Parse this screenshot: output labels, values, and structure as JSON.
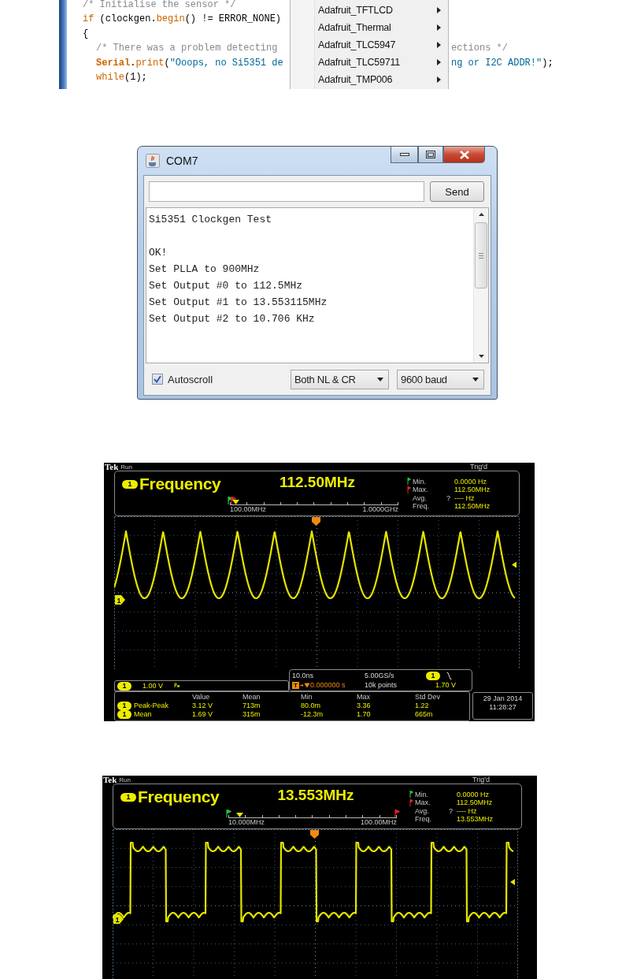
{
  "code_editor": {
    "lines": [
      {
        "left": [
          {
            "kind": "comment",
            "text": "/* Initialise the sensor */"
          }
        ]
      },
      {
        "left": [
          {
            "kind": "keyword",
            "text": "if"
          },
          {
            "kind": "plain",
            "text": " (clockgen."
          },
          {
            "kind": "function",
            "text": "begin"
          },
          {
            "kind": "plain",
            "text": "() != ERROR_NONE)"
          }
        ]
      },
      {
        "left": [
          {
            "kind": "plain",
            "text": "{"
          }
        ]
      },
      {
        "indented": true,
        "left": [
          {
            "kind": "comment",
            "text": "/* There was a problem detecting"
          }
        ],
        "right": [
          {
            "kind": "comment",
            "text": "ections */"
          }
        ]
      },
      {
        "indented": true,
        "left": [
          {
            "kind": "class",
            "text": "Serial"
          },
          {
            "kind": "plain",
            "text": "."
          },
          {
            "kind": "function",
            "text": "print"
          },
          {
            "kind": "plain",
            "text": "("
          },
          {
            "kind": "string",
            "text": "\"Ooops, no Si5351 de"
          }
        ],
        "right": [
          {
            "kind": "string",
            "text": "ng or I2C ADDR!\""
          },
          {
            "kind": "plain",
            "text": ");"
          }
        ]
      },
      {
        "indented": true,
        "left": [
          {
            "kind": "keyword",
            "text": "while"
          },
          {
            "kind": "plain",
            "text": "(1);"
          }
        ]
      }
    ],
    "menu_items": [
      {
        "label": "Adafruit_TFTLCD",
        "submenu": true
      },
      {
        "label": "Adafruit_Thermal",
        "submenu": true
      },
      {
        "label": "Adafruit_TLC5947",
        "submenu": true
      },
      {
        "label": "Adafruit_TLC59711",
        "submenu": true
      },
      {
        "label": "Adafruit_TMP006",
        "submenu": true
      }
    ]
  },
  "serial_monitor": {
    "title": "COM7",
    "send_button": "Send",
    "output_lines": [
      {
        "text": "Si5351 Clockgen Test",
        "gap_before": false
      },
      {
        "text": "OK!",
        "gap_before": true
      },
      {
        "text": "Set PLLA to 900MHz",
        "gap_before": false
      },
      {
        "text": "Set Output #0 to 112.5MHz",
        "gap_before": false
      },
      {
        "text": "Set Output #1 to 13.553115MHz",
        "gap_before": false
      },
      {
        "text": "Set Output #2 to 10.706 KHz",
        "gap_before": false
      }
    ],
    "autoscroll": {
      "label": "Autoscroll",
      "checked": true
    },
    "line_ending": "Both NL & CR",
    "baud_rate": "9600 baud"
  },
  "scopes": [
    {
      "brand": "Tek",
      "run_status": "Run",
      "trigger_status": "Trig'd",
      "measurement": {
        "channel": "1",
        "name": "Frequency",
        "value": "112.50MHz",
        "scale_start": "100.00MHz",
        "scale_end": "1.0000GHz",
        "scale_markers": [
          {
            "kind": "min",
            "level": 0
          },
          {
            "kind": "max",
            "level": 0.02
          },
          {
            "kind": "current",
            "level": 0.03
          }
        ],
        "stats": [
          {
            "kind": "min",
            "label": "Min.",
            "value": "0.0000 Hz"
          },
          {
            "kind": "max",
            "label": "Max.",
            "value": "112.50MHz"
          },
          {
            "kind": "avg",
            "label": "Avg.",
            "note": "?",
            "value": "---- Hz"
          },
          {
            "kind": "freq",
            "label": "Freq.",
            "value": "112.50MHz"
          }
        ]
      },
      "waveform": {
        "kind": "sine",
        "channel": "1"
      },
      "vertical": {
        "channel": "1",
        "scale": "1.00 V"
      },
      "timebase": {
        "time_per_div": "10.0ns",
        "sample_rate": "5.00GS/s",
        "trigger_channel": "1",
        "trigger_symbol": "T",
        "trigger_position": "0.000000 s",
        "record_length": "10k points",
        "trigger_level": "1.70 V"
      },
      "stats_table": {
        "columns": [
          "Value",
          "Mean",
          "Min",
          "Max",
          "Std Dev"
        ],
        "rows": [
          {
            "channel": "1",
            "label": "Peak-Peak",
            "cells": [
              "3.12 V",
              "713m",
              "80.0m",
              "3.36",
              "1.22"
            ]
          },
          {
            "channel": "1",
            "label": "Mean",
            "cells": [
              "1.69 V",
              "315m",
              "-12.3m",
              "1.70",
              "665m"
            ]
          }
        ]
      },
      "date": "29 Jan 2014",
      "time": "11:28:27"
    },
    {
      "brand": "Tek",
      "run_status": "Run",
      "trigger_status": "Trig'd",
      "measurement": {
        "channel": "1",
        "name": "Frequency",
        "value": "13.553MHz",
        "scale_start": "10.000MHz",
        "scale_end": "100.00MHz",
        "scale_markers": [
          {
            "kind": "min",
            "level": 0
          },
          {
            "kind": "max",
            "level": 1
          },
          {
            "kind": "current",
            "level": 0.06
          }
        ],
        "stats": [
          {
            "kind": "min",
            "label": "Min.",
            "value": "0.0000 Hz"
          },
          {
            "kind": "max",
            "label": "Max.",
            "value": "112.50MHz"
          },
          {
            "kind": "avg",
            "label": "Avg.",
            "note": "?",
            "value": "---- Hz"
          },
          {
            "kind": "freq",
            "label": "Freq.",
            "value": "13.553MHz"
          }
        ]
      },
      "waveform": {
        "kind": "square",
        "channel": "1"
      }
    }
  ]
}
